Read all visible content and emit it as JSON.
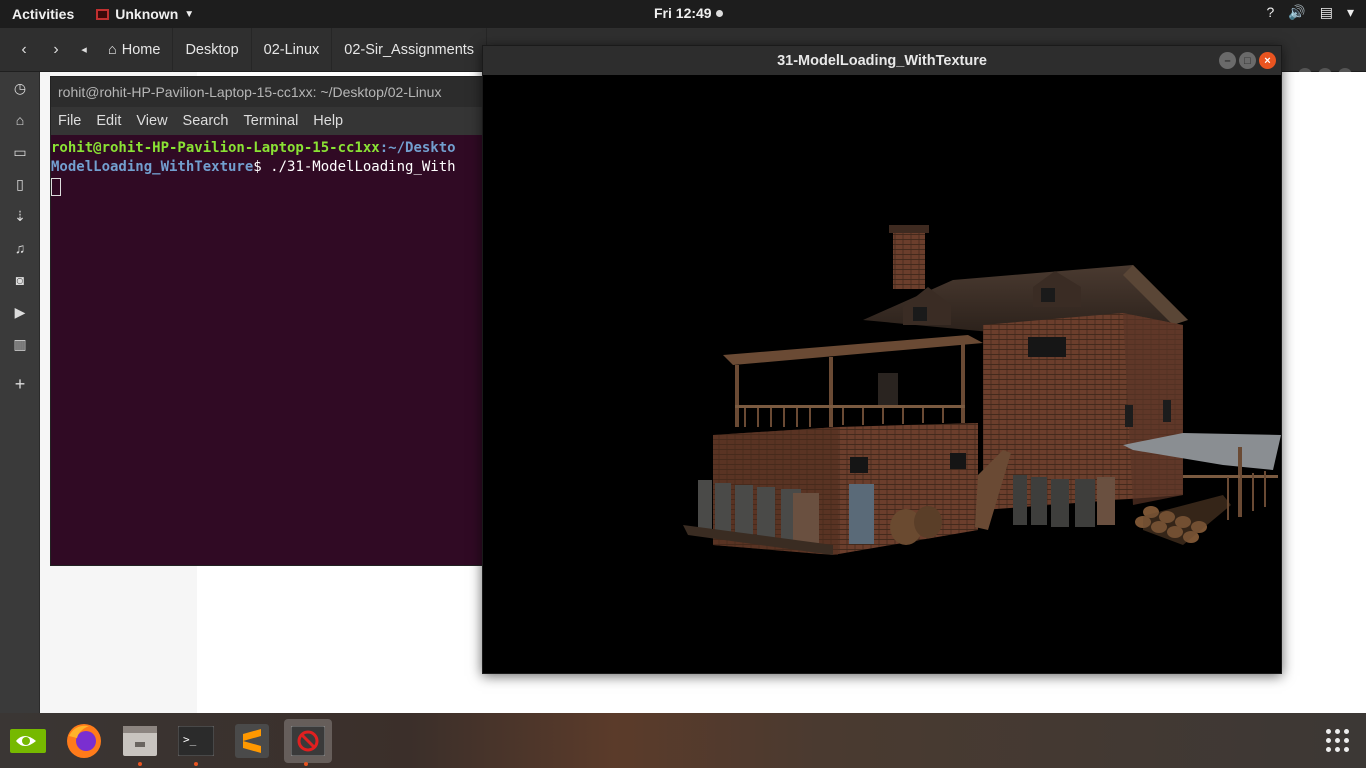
{
  "topbar": {
    "activities": "Activities",
    "app_name": "Unknown",
    "clock": "Fri 12:49",
    "help_icon": "?"
  },
  "nautilus": {
    "breadcrumbs": [
      "Home",
      "Desktop",
      "02-Linux",
      "02-Sir_Assignments"
    ]
  },
  "terminal": {
    "title": "rohit@rohit-HP-Pavilion-Laptop-15-cc1xx: ~/Desktop/02-Linux",
    "menu": [
      "File",
      "Edit",
      "View",
      "Search",
      "Terminal",
      "Help"
    ],
    "prompt_user": "rohit@rohit-HP-Pavilion-Laptop-15-cc1xx",
    "prompt_path_1": ":~/Deskto",
    "prompt_path_2": "ModelLoading_WithTexture",
    "command": "$ ./31-ModelLoading_With"
  },
  "glwindow": {
    "title": "31-ModelLoading_WithTexture"
  },
  "dock_icons": [
    "recent-icon",
    "home-icon",
    "folder-icon",
    "documents-icon",
    "downloads-icon",
    "music-icon",
    "camera-icon",
    "videos-icon",
    "trash-icon",
    "add-icon"
  ],
  "taskbar_icons": [
    "nvidia-icon",
    "firefox-icon",
    "files-icon",
    "terminal-icon",
    "sublime-icon",
    "glapp-icon"
  ],
  "colors": {
    "accent": "#e95420",
    "terminal_bg": "#300a24",
    "prompt_user": "#8ae234",
    "prompt_path": "#729fcf"
  }
}
